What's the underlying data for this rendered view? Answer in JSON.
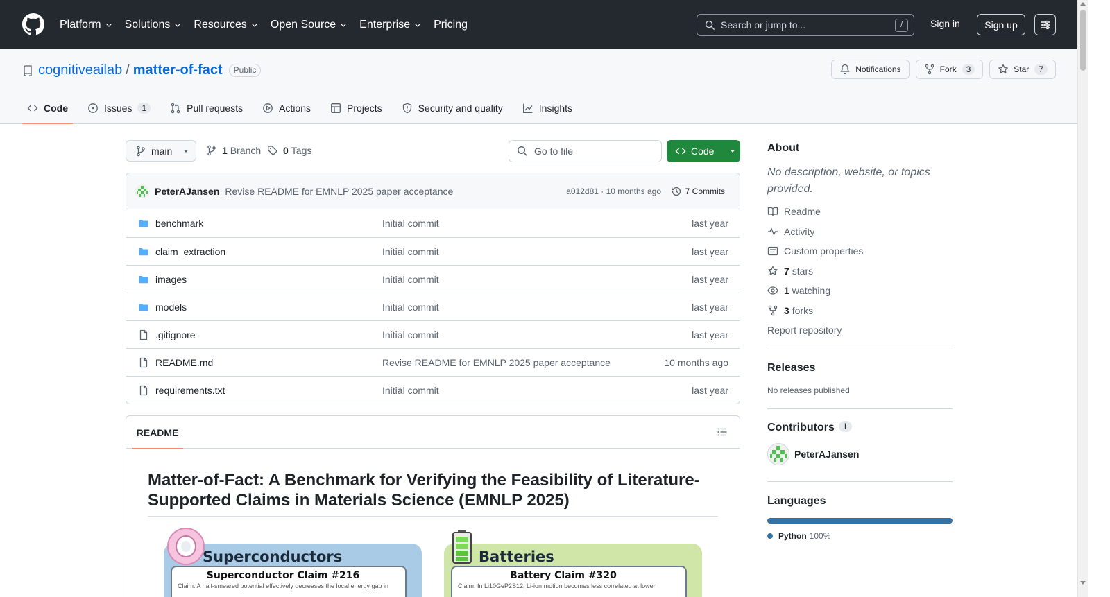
{
  "header": {
    "nav": [
      "Platform",
      "Solutions",
      "Resources",
      "Open Source",
      "Enterprise",
      "Pricing"
    ],
    "search_placeholder": "Search or jump to...",
    "search_key": "/",
    "sign_in": "Sign in",
    "sign_up": "Sign up"
  },
  "repo": {
    "owner": "cognitiveailab",
    "separator": "/",
    "name": "matter-of-fact",
    "visibility": "Public",
    "notifications_label": "Notifications",
    "fork_label": "Fork",
    "fork_count": "3",
    "star_label": "Star",
    "star_count": "7"
  },
  "tabs": [
    {
      "label": "Code",
      "icon": "code-icon",
      "active": true
    },
    {
      "label": "Issues",
      "icon": "issue-icon",
      "count": "1"
    },
    {
      "label": "Pull requests",
      "icon": "pull-request-icon"
    },
    {
      "label": "Actions",
      "icon": "play-icon"
    },
    {
      "label": "Projects",
      "icon": "table-icon"
    },
    {
      "label": "Security and quality",
      "icon": "shield-icon"
    },
    {
      "label": "Insights",
      "icon": "graph-icon"
    }
  ],
  "toolbar": {
    "branch": "main",
    "branch_count": "1",
    "branch_label": "Branch",
    "tag_count": "0",
    "tag_label": "Tags",
    "go_to_file": "Go to file",
    "code_button": "Code"
  },
  "latest_commit": {
    "author": "PeterAJansen",
    "message": "Revise README for EMNLP 2025 paper acceptance",
    "hash_age": "a012d81 · 10 months ago",
    "commits_label": "7 Commits"
  },
  "files": [
    {
      "name": "benchmark",
      "type": "folder",
      "message": "Initial commit",
      "age": "last year"
    },
    {
      "name": "claim_extraction",
      "type": "folder",
      "message": "Initial commit",
      "age": "last year"
    },
    {
      "name": "images",
      "type": "folder",
      "message": "Initial commit",
      "age": "last year"
    },
    {
      "name": "models",
      "type": "folder",
      "message": "Initial commit",
      "age": "last year"
    },
    {
      "name": ".gitignore",
      "type": "file",
      "message": "Initial commit",
      "age": "last year"
    },
    {
      "name": "README.md",
      "type": "file",
      "message": "Revise README for EMNLP 2025 paper acceptance",
      "age": "10 months ago"
    },
    {
      "name": "requirements.txt",
      "type": "file",
      "message": "Initial commit",
      "age": "last year"
    }
  ],
  "readme": {
    "tab": "README",
    "title": "Matter-of-Fact: A Benchmark for Verifying the Feasibility of Literature-Supported Claims in Materials Science (EMNLP 2025)",
    "figures": [
      {
        "heading": "Superconductors",
        "card_title": "Superconductor Claim #216",
        "card_text": "Claim: A half-smeared potential effectively decreases the local energy gap in",
        "color": "#a9cbe6"
      },
      {
        "heading": "Batteries",
        "card_title": "Battery Claim #320",
        "card_text": "Claim: In Li10GeP2S12, Li-ion motion becomes less correlated at lower",
        "color": "#cfe6a8"
      }
    ]
  },
  "sidebar": {
    "about_title": "About",
    "about_desc": "No description, website, or topics provided.",
    "links": [
      {
        "icon": "book-icon",
        "label": "Readme"
      },
      {
        "icon": "pulse-icon",
        "label": "Activity"
      },
      {
        "icon": "note-icon",
        "label": "Custom properties"
      },
      {
        "icon": "star-icon",
        "count": "7",
        "label": "stars"
      },
      {
        "icon": "eye-icon",
        "count": "1",
        "label": "watching"
      },
      {
        "icon": "fork-icon",
        "count": "3",
        "label": "forks"
      }
    ],
    "report": "Report repository",
    "releases_title": "Releases",
    "releases_text": "No releases published",
    "contributors_title": "Contributors",
    "contributors_count": "1",
    "contributor": "PeterAJansen",
    "languages_title": "Languages",
    "language": "Python",
    "language_pct": "100%",
    "language_color": "#3572A5"
  }
}
